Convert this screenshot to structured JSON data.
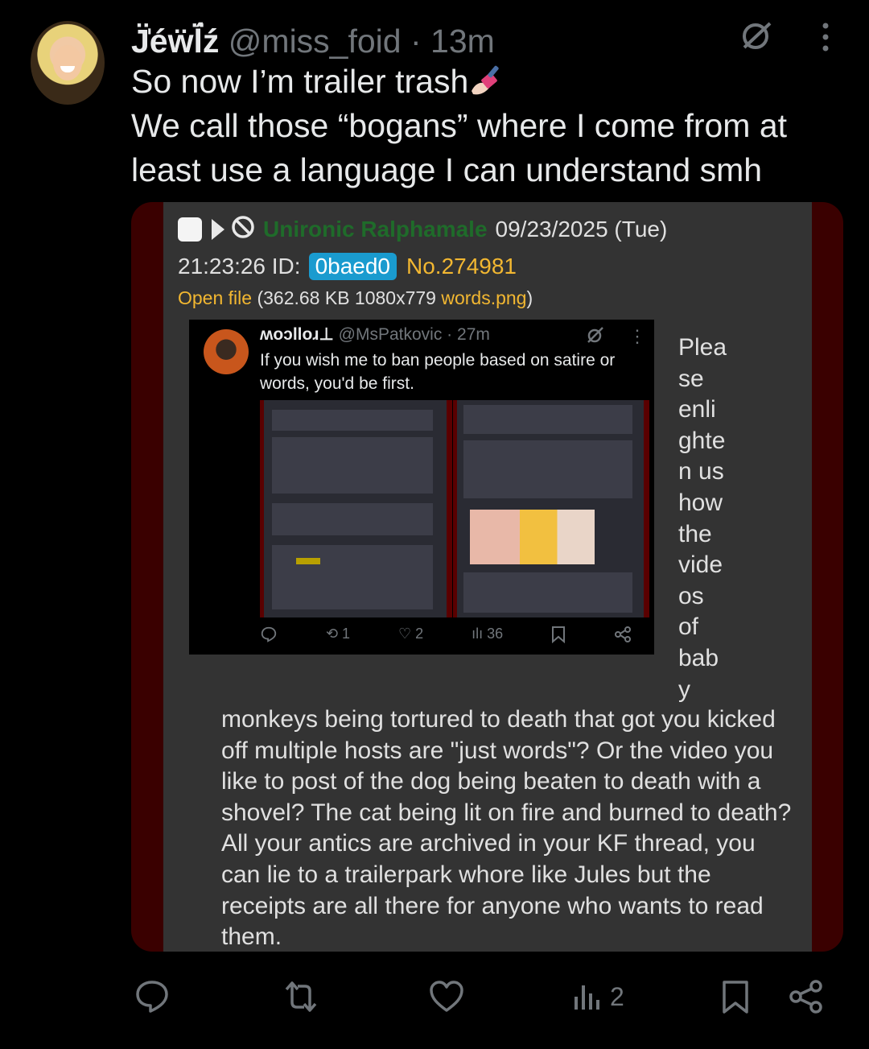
{
  "tweet": {
    "display_name": "J̈̍éẅl̈́ź",
    "handle": "@miss_foid",
    "time": "13m",
    "text_line1": "So now I’m trailer trash",
    "text_rest": "We call those “bogans” where I come from at least use a language I can understand smh",
    "emoji_icon": "nail-polish-emoji",
    "views": "2"
  },
  "post": {
    "poster_name": "Unironic Ralphamale",
    "date": "09/23/2025 (Tue)",
    "time": "21:23:26",
    "id_label": "ID:",
    "id_value": "0baed0",
    "number": "No.274981",
    "open_file": "Open file",
    "file_info_pre": "(362.68 KB 1080x779 ",
    "file_name": "words.png",
    "file_info_post": ")",
    "side_text": [
      "Plea",
      "se",
      "enli",
      "ghte",
      "n us",
      "how",
      "the",
      "vide",
      "os",
      "of",
      "bab",
      "y"
    ],
    "body_text": "monkeys being tortured to death that got you kicked off multiple hosts are \"just words\"? Or the video you like to post of the dog being beaten to death with a shovel? The cat being lit on fire and burned to death? All your antics are archived in your KF thread, you can lie to a trailerpark whore like Jules but the receipts are all there for anyone who wants to read them."
  },
  "embedded": {
    "display_name": "ʍoɔlloɹ⊥",
    "handle": "@MsPatkovic",
    "time": "27m",
    "text": "If you wish me to ban people based on satire or words, you'd be first.",
    "retweets": "1",
    "likes": "2",
    "views": "36"
  },
  "colors": {
    "background": "#000000",
    "muted": "#71767b",
    "panel": "#333333",
    "card_border": "#3a0000",
    "poster_green": "#1f6b2a",
    "post_no": "#f2b731",
    "id_badge": "#1a9bcf"
  }
}
